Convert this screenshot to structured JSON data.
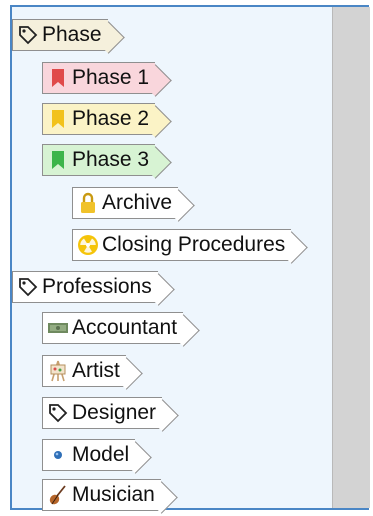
{
  "tree": {
    "items": [
      {
        "label": "Phase",
        "icon": "tag-outline-icon"
      },
      {
        "label": "Phase 1",
        "icon": "red-bookmark-icon"
      },
      {
        "label": "Phase 2",
        "icon": "yellow-bookmark-icon"
      },
      {
        "label": "Phase 3",
        "icon": "green-bookmark-icon"
      },
      {
        "label": "Archive",
        "icon": "lock-icon"
      },
      {
        "label": "Closing Procedures",
        "icon": "radiation-icon"
      },
      {
        "label": "Professions",
        "icon": "tag-outline-icon"
      },
      {
        "label": "Accountant",
        "icon": "money-icon"
      },
      {
        "label": "Artist",
        "icon": "easel-icon"
      },
      {
        "label": "Designer",
        "icon": "tag-outline-icon"
      },
      {
        "label": "Model",
        "icon": "dot-icon"
      },
      {
        "label": "Musician",
        "icon": "violin-icon"
      }
    ]
  },
  "colors": {
    "panel_border": "#4a86c5",
    "panel_bg": "#eef6fd",
    "red_tag": "#f9d6dc",
    "yellow_tag": "#fbf3c6",
    "green_tag": "#d7f3d3"
  }
}
